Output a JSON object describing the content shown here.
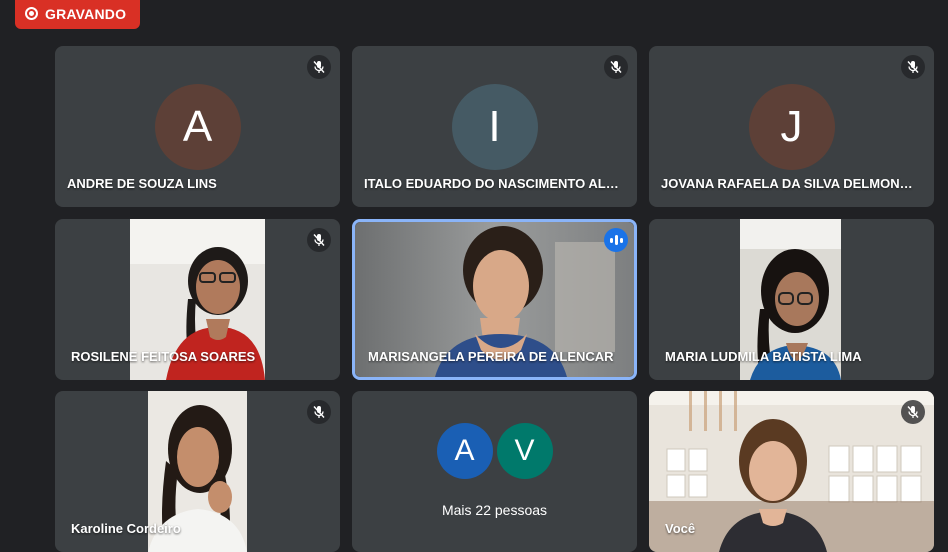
{
  "recording": {
    "label": "GRAVANDO"
  },
  "participants": [
    {
      "name": "ANDRE DE SOUZA LINS",
      "initial": "A",
      "avatar_color": "#5d4037",
      "muted": true
    },
    {
      "name": "ITALO EDUARDO DO NASCIMENTO ALMEIDA",
      "initial": "I",
      "avatar_color": "#455a64",
      "muted": true
    },
    {
      "name": "JOVANA RAFAELA DA SILVA DELMONDES",
      "initial": "J",
      "avatar_color": "#5d4037",
      "muted": true
    },
    {
      "name": "ROSILENE FEITOSA SOARES",
      "muted": true
    },
    {
      "name": "MARISANGELA PEREIRA DE ALENCAR",
      "speaking": true
    },
    {
      "name": "MARIA LUDMILA BATISTA LIMA",
      "muted": false
    },
    {
      "name": "Karoline Cordeiro",
      "muted": true
    },
    {
      "name": "Você",
      "muted": true
    }
  ],
  "more": {
    "label": "Mais 22 pessoas",
    "avatars": [
      {
        "initial": "A",
        "color": "#1a5fb4"
      },
      {
        "initial": "V",
        "color": "#00796b"
      }
    ]
  },
  "colors": {
    "active_border": "#8ab4f8",
    "recording": "#d93025",
    "tile_bg": "#3c4043"
  }
}
